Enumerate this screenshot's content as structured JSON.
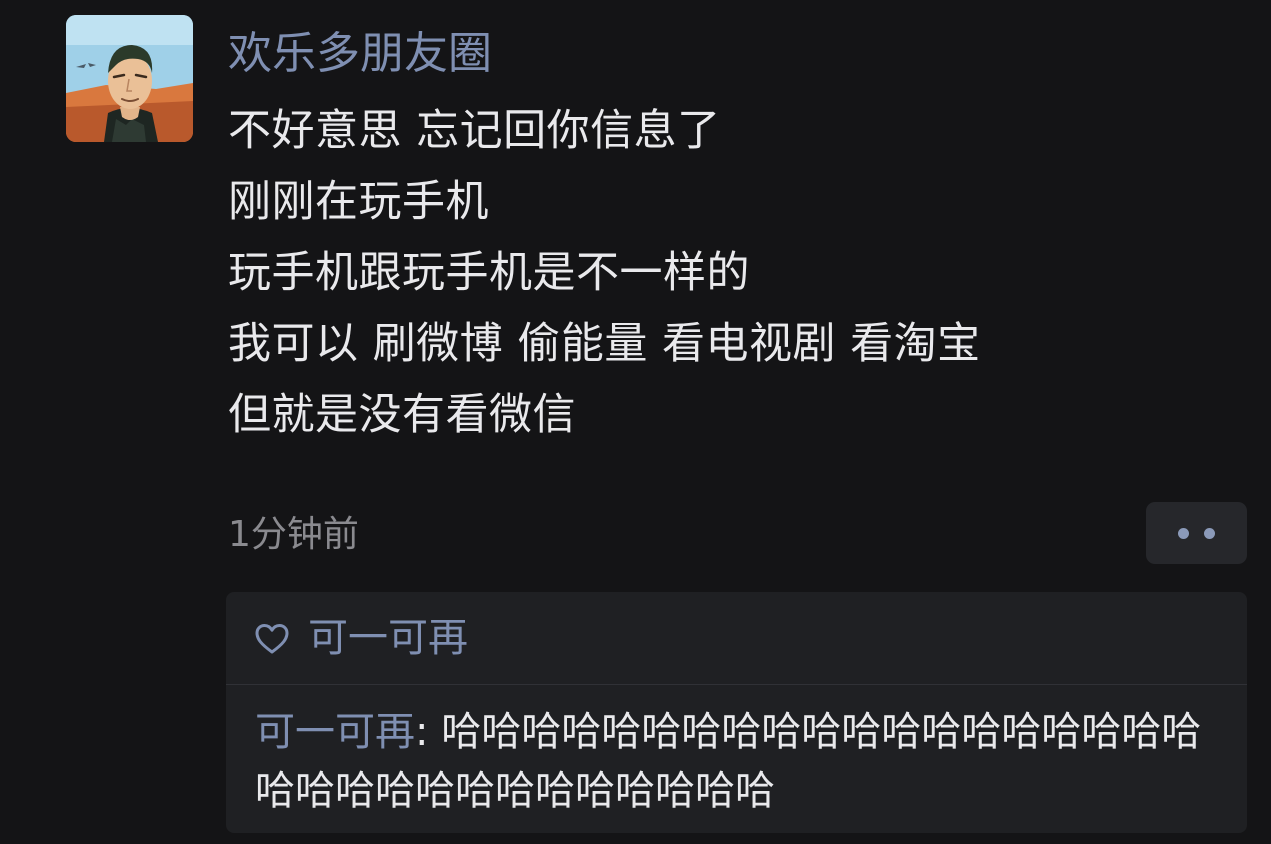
{
  "post": {
    "author": "欢乐多朋友圈",
    "lines": [
      "不好意思 忘记回你信息了",
      "刚刚在玩手机",
      "玩手机跟玩手机是不一样的",
      "我可以 刷微博 偷能量 看电视剧 看淘宝",
      "但就是没有看微信"
    ],
    "timestamp": "1分钟前"
  },
  "more_button": {
    "icon": "more-dots-icon"
  },
  "likes": {
    "icon": "heart-outline-icon",
    "names": "可一可再"
  },
  "comments": [
    {
      "author": "可一可再",
      "separator": ": ",
      "text": "哈哈哈哈哈哈哈哈哈哈哈哈哈哈哈哈哈哈哈哈哈哈哈哈哈哈哈哈哈哈哈哈"
    }
  ],
  "colors": {
    "background": "#141416",
    "link_blue": "#7f8fb2",
    "text": "#e9e9ec",
    "muted": "#8a8a8f",
    "panel": "#1f2023"
  }
}
